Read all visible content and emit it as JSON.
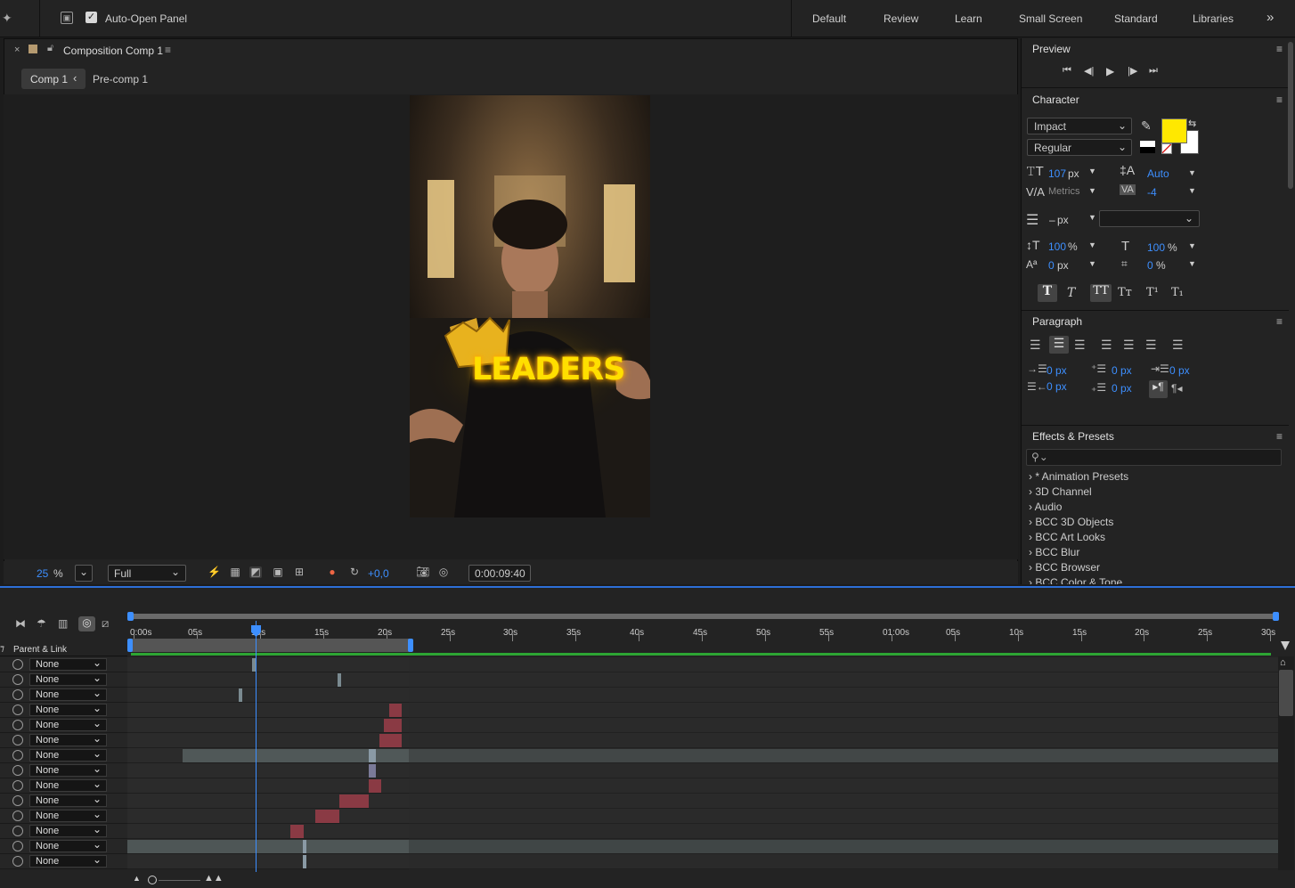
{
  "topbar": {
    "auto_open_label": "Auto-Open Panel",
    "workspaces": [
      "Default",
      "Review",
      "Learn",
      "Small Screen",
      "Standard",
      "Libraries"
    ],
    "more": "»"
  },
  "composition": {
    "tab_title": "Composition Comp 1",
    "breadcrumbs": [
      "Comp 1",
      "Pre-comp 1"
    ],
    "overlay_text": "LEADERS",
    "zoom": "25",
    "zoom_unit": "%",
    "resolution": "Full",
    "exposure": "+0,0",
    "timecode": "0:00:09:40"
  },
  "preview": {
    "title": "Preview"
  },
  "character": {
    "title": "Character",
    "font": "Impact",
    "style": "Regular",
    "fill_color": "#FFE800",
    "size": "107",
    "size_unit": "px",
    "leading": "Auto",
    "kerning": "Metrics",
    "tracking": "-4",
    "stroke_width": "–",
    "stroke_unit": "px",
    "vscale": "100",
    "hscale": "100",
    "baseline": "0",
    "tsume": "0",
    "pct": "%",
    "px": "px"
  },
  "paragraph": {
    "title": "Paragraph",
    "indent_left": "0",
    "space_before": "0",
    "indent_right": "0",
    "indent_first": "0",
    "space_after": "0",
    "unit": "px"
  },
  "effects": {
    "title": "Effects & Presets",
    "items": [
      "* Animation Presets",
      "3D Channel",
      "Audio",
      "BCC 3D Objects",
      "BCC Art Looks",
      "BCC Blur",
      "BCC Browser",
      "BCC Color & Tone"
    ]
  },
  "timeline": {
    "parent_header": "Parent & Link",
    "ruler_labels": [
      "0:00s",
      "05s",
      "10s",
      "15s",
      "20s",
      "25s",
      "30s",
      "35s",
      "40s",
      "45s",
      "50s",
      "55s",
      "01:00s",
      "05s",
      "10s",
      "15s",
      "20s",
      "25s",
      "30s"
    ],
    "parent_values": [
      "None",
      "None",
      "None",
      "None",
      "None",
      "None",
      "None",
      "None",
      "None",
      "None",
      "None",
      "None",
      "None",
      "None"
    ]
  }
}
